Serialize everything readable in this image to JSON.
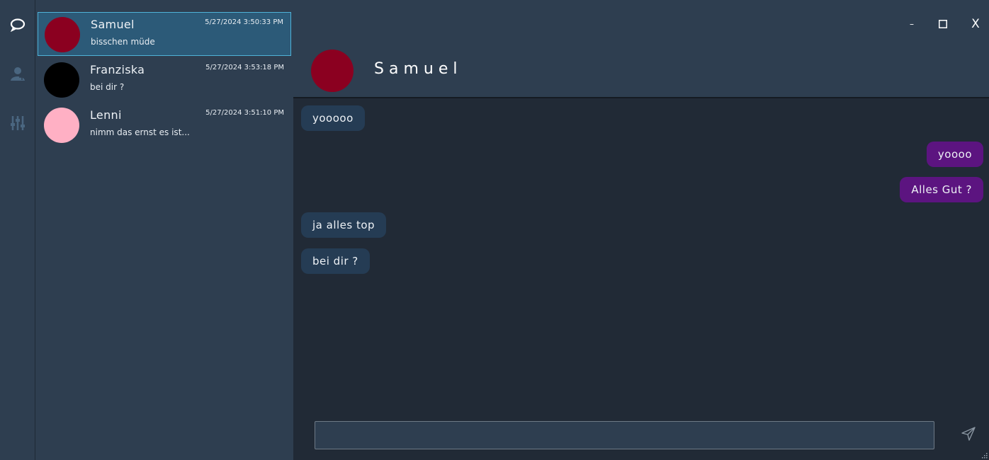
{
  "window": {
    "minimize_label": "–",
    "maximize_icon": "square-icon",
    "close_label": "X"
  },
  "nav": {
    "items": [
      {
        "name": "chats",
        "icon": "chat-bubble-icon"
      },
      {
        "name": "contacts",
        "icon": "contacts-icon"
      },
      {
        "name": "settings",
        "icon": "sliders-icon"
      }
    ]
  },
  "conversations": [
    {
      "name": "Samuel",
      "time": "5/27/2024 3:50:33 PM",
      "preview": "bisschen müde",
      "avatar_color": "#8b0020",
      "selected": true
    },
    {
      "name": "Franziska",
      "time": "5/27/2024 3:53:18 PM",
      "preview": "bei dir ?",
      "avatar_color": "#000000",
      "selected": false
    },
    {
      "name": "Lenni",
      "time": "5/27/2024 3:51:10 PM",
      "preview": "nimm das ernst es ist...",
      "avatar_color": "#ffb0c4",
      "selected": false
    }
  ],
  "chat": {
    "title": "Samuel",
    "avatar_color": "#8b0020",
    "messages": [
      {
        "text": "yooooo",
        "direction": "in"
      },
      {
        "text": "yoooo",
        "direction": "out"
      },
      {
        "text": "Alles Gut ?",
        "direction": "out"
      },
      {
        "text": "ja alles top",
        "direction": "in"
      },
      {
        "text": "bei dir ?",
        "direction": "in"
      }
    ],
    "composer": {
      "value": "",
      "placeholder": ""
    }
  },
  "colors": {
    "incoming_bubble": "#253c54",
    "outgoing_bubble": "#5c1480",
    "selection_border": "#4fb2d8"
  }
}
